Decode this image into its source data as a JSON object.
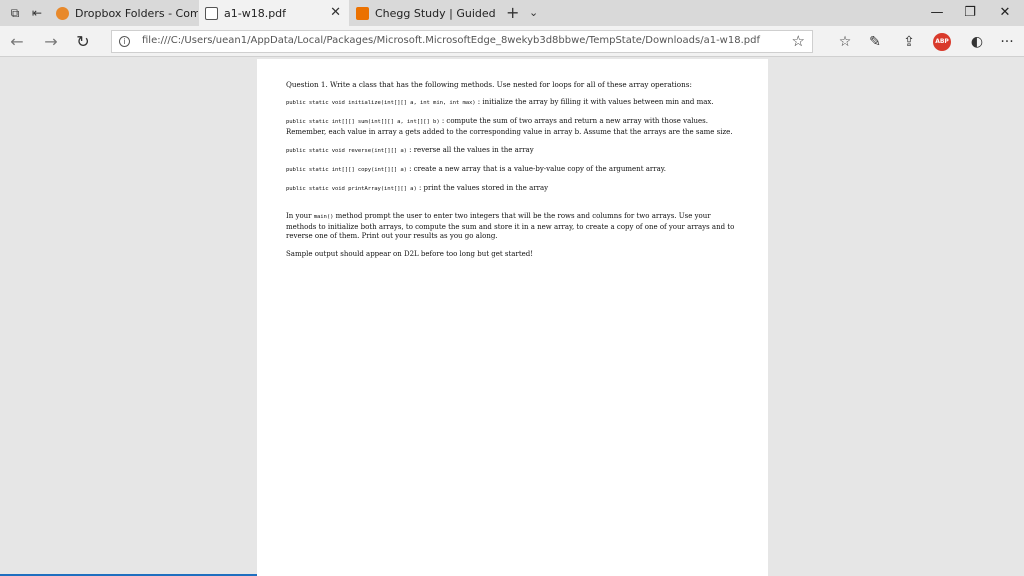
{
  "tabs": [
    {
      "title": "Dropbox Folders - Compute",
      "icon": "dropbox-icon",
      "color": "#e8892b"
    },
    {
      "title": "a1-w18.pdf",
      "icon": "pdf-icon",
      "color": "#555555"
    },
    {
      "title": "Chegg Study | Guided Solut",
      "icon": "chegg-icon",
      "color": "#eb7100"
    }
  ],
  "address": {
    "url": "file:///C:/Users/uean1/AppData/Local/Packages/Microsoft.MicrosoftEdge_8wekyb3d8bbwe/TempState/Downloads/a1-w18.pdf"
  },
  "toolbar": {
    "abp_label": "ABP"
  },
  "document": {
    "question_title": "Question 1.  Write a class that has the following methods.  Use nested for loops for all of these array operations:",
    "methods": [
      {
        "signature": "public static void initialize(int[][] a, int min, int max)",
        "desc": " : initialize the array by filling it with values between min and max."
      },
      {
        "signature": "public static int[][] sum(int[][] a, int[][] b)",
        "desc": " : compute the sum of two arrays and return a new array with those values.  Remember, each value in array a gets added to the corresponding value in array b.  Assume that the arrays are the same size."
      },
      {
        "signature": "public static void reverse(int[][] a)",
        "desc": " : reverse all the values in the array"
      },
      {
        "signature": "public static int[][] copy(int[][] a)",
        "desc": " : create a new array that is a value-by-value copy of the argument array."
      },
      {
        "signature": "public static void printArray(int[][] a)",
        "desc": " : print the values stored in the array"
      }
    ],
    "main_pre": "In your ",
    "main_code": "main()",
    "main_post": " method prompt the user to enter two integers that will be the rows and columns for two arrays.  Use your methods to initialize both arrays, to compute the sum and store it in a new array, to create a copy of one of your arrays and to reverse one of them.  Print out your results as you go along.",
    "closing": "Sample output should appear on D2L before too long but get started!"
  }
}
